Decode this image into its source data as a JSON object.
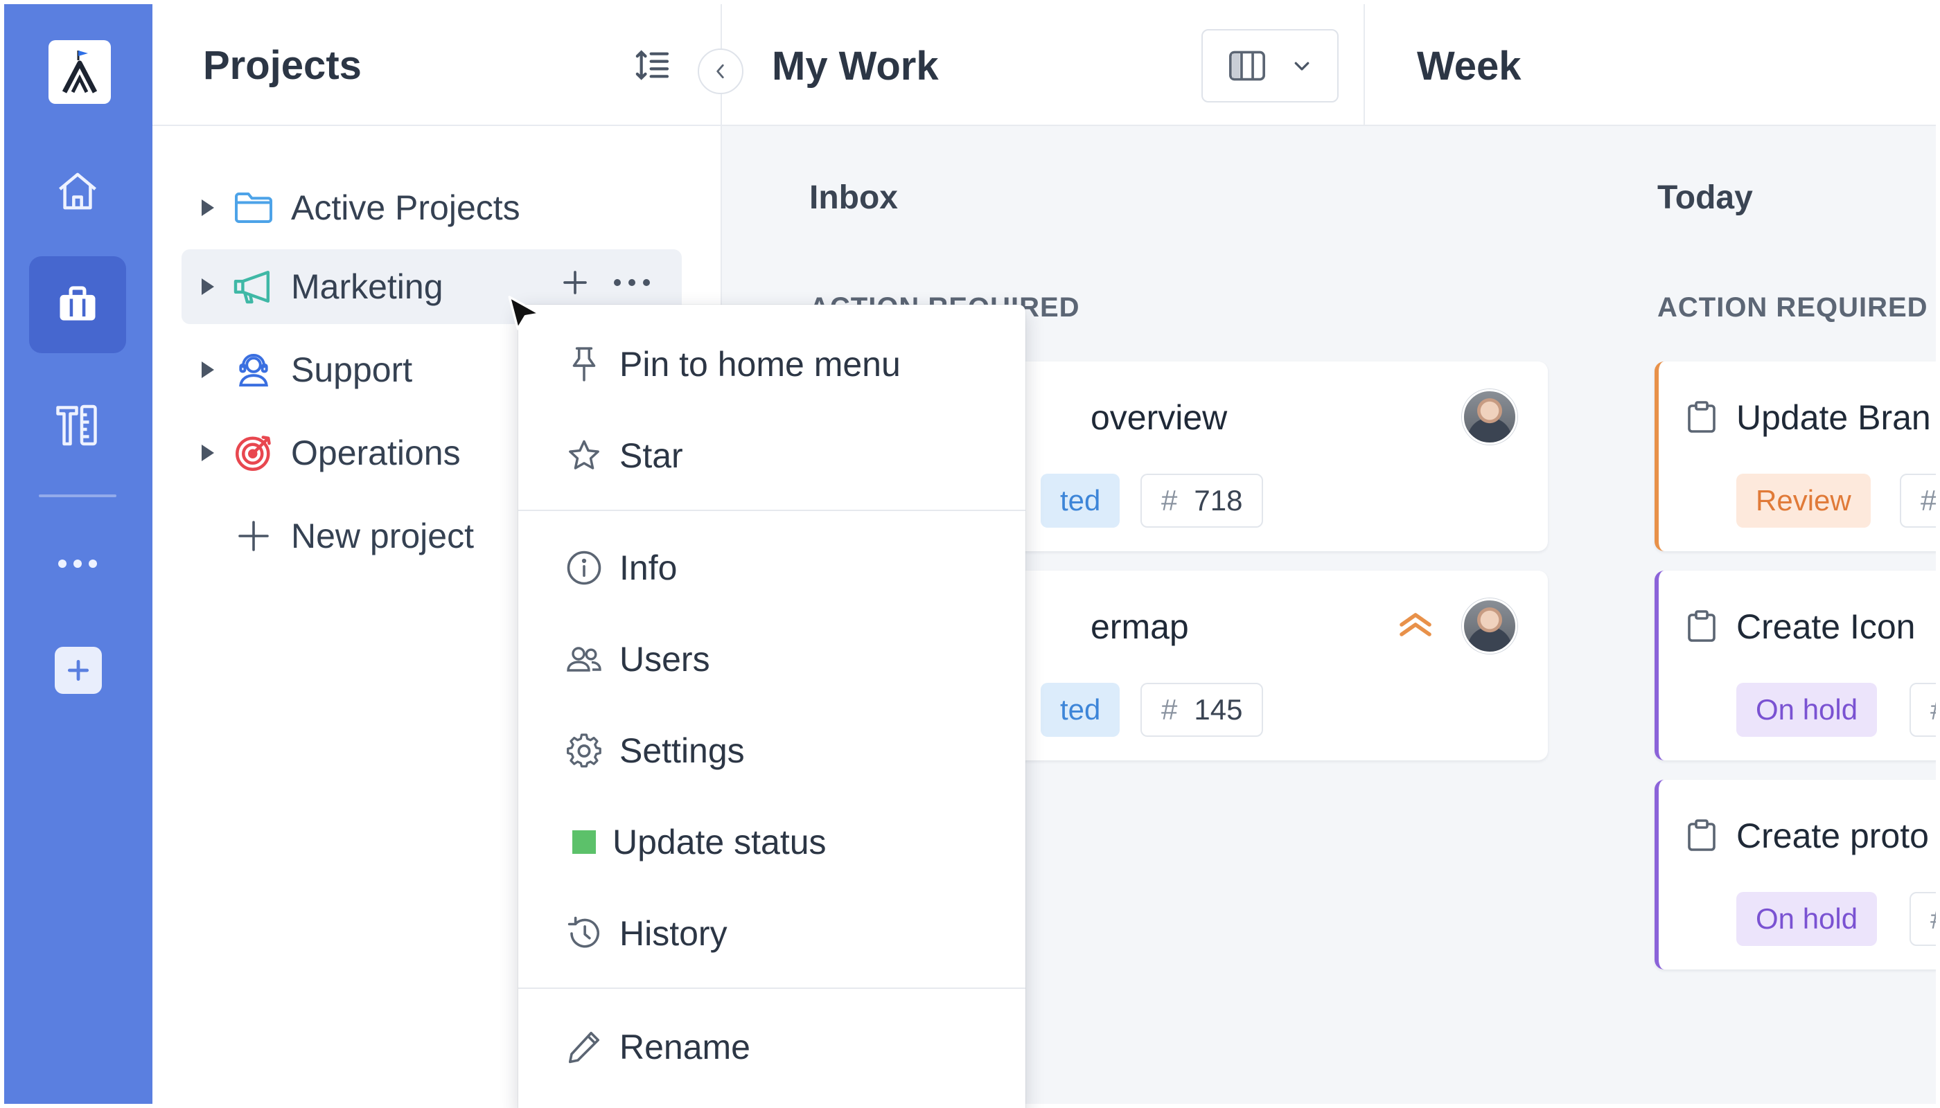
{
  "app": {
    "name": "Project management app"
  },
  "rail": {
    "items": [
      {
        "icon": "home-icon"
      },
      {
        "icon": "briefcase-icon",
        "active": true
      },
      {
        "icon": "tools-icon"
      },
      {
        "icon": "more-icon"
      },
      {
        "icon": "add-icon"
      }
    ]
  },
  "projects": {
    "title": "Projects",
    "items": [
      {
        "label": "Active Projects",
        "icon": "folder-icon",
        "color": "#4da3e8"
      },
      {
        "label": "Marketing",
        "icon": "megaphone-icon",
        "color": "#3fb8a6"
      },
      {
        "label": "Support",
        "icon": "support-icon",
        "color": "#3a6fe0"
      },
      {
        "label": "Operations",
        "icon": "target-icon",
        "color": "#e8474f"
      }
    ],
    "new_project_label": "New project"
  },
  "main": {
    "title": "My Work",
    "week_title": "Week",
    "columns": [
      {
        "title": "Inbox",
        "section": "ACTION REQUIRED"
      },
      {
        "title": "Today",
        "section": "ACTION REQUIRED"
      }
    ],
    "inbox_cards": [
      {
        "title": "overview",
        "status": "ted",
        "number": "718",
        "priority": ""
      },
      {
        "title": "ermap",
        "status": "ted",
        "number": "145",
        "priority": "high-priority-icon"
      }
    ],
    "today_cards": [
      {
        "title": "Update Bran",
        "status": "Review",
        "accent": "#e8914a"
      },
      {
        "title": "Create Icon",
        "status": "On hold",
        "accent": "#8b63d9"
      },
      {
        "title": "Create proto",
        "status": "On hold",
        "accent": "#8b63d9"
      }
    ],
    "hash": "#"
  },
  "context_menu": {
    "items": [
      {
        "label": "Pin to home menu",
        "icon": "pin-icon"
      },
      {
        "label": "Star",
        "icon": "star-icon"
      },
      {
        "label": "Info",
        "icon": "info-icon"
      },
      {
        "label": "Users",
        "icon": "users-icon"
      },
      {
        "label": "Settings",
        "icon": "gear-icon"
      },
      {
        "label": "Update status",
        "icon": "status-square-icon",
        "color": "#5cc16a"
      },
      {
        "label": "History",
        "icon": "history-icon"
      },
      {
        "label": "Rename",
        "icon": "pencil-icon"
      }
    ]
  }
}
